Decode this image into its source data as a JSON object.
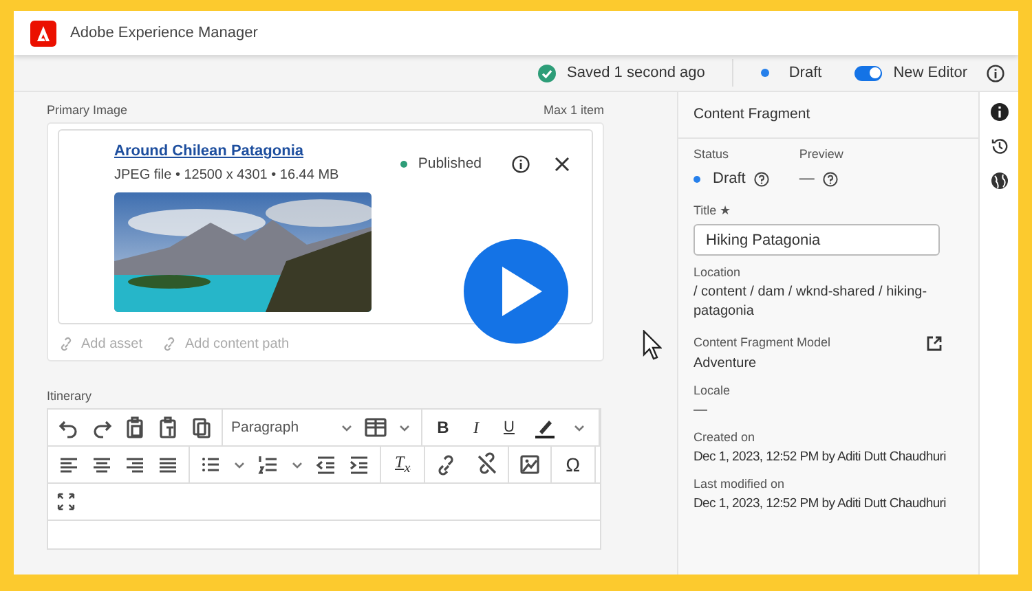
{
  "app": {
    "title": "Adobe Experience Manager"
  },
  "toolbar": {
    "save_status": "Saved 1 second ago",
    "status": {
      "label": "Draft",
      "color": "#2680eb"
    },
    "editor_toggle": {
      "label": "New Editor",
      "on": true
    }
  },
  "primary_image": {
    "label": "Primary Image",
    "limit": "Max 1 item",
    "asset": {
      "title": "Around Chilean Patagonia",
      "meta": "JPEG file • 12500 x 4301 • 16.44 MB",
      "status": {
        "label": "Published",
        "color": "#2d9d78"
      }
    },
    "actions": [
      "Add asset",
      "Add content path"
    ]
  },
  "itinerary": {
    "label": "Itinerary",
    "format_select": "Paragraph",
    "bold": "B",
    "italic": "I",
    "underline": "U",
    "clear_format": "T$_{x}$",
    "special_char": "Ω"
  },
  "properties": {
    "heading": "Content Fragment",
    "status": {
      "label": "Status",
      "value": "Draft",
      "color": "#2680eb"
    },
    "preview_label": "Preview",
    "preview_value": "—",
    "title_label": "Title ★",
    "title_value": "Hiking Patagonia",
    "location_label": "Location",
    "location_value": "/ content / dam / wknd-shared / hiking-patagonia",
    "model_label": "Content Fragment Model",
    "model_value": "Adventure",
    "locale_label": "Locale",
    "locale_value": "—",
    "created_label": "Created on",
    "created_value": "Dec 1, 2023, 12:52 PM by Aditi Dutt Chaudhuri",
    "modified_label": "Last modified on",
    "modified_value": "Dec 1, 2023, 12:52 PM by Aditi Dutt Chaudhuri"
  }
}
